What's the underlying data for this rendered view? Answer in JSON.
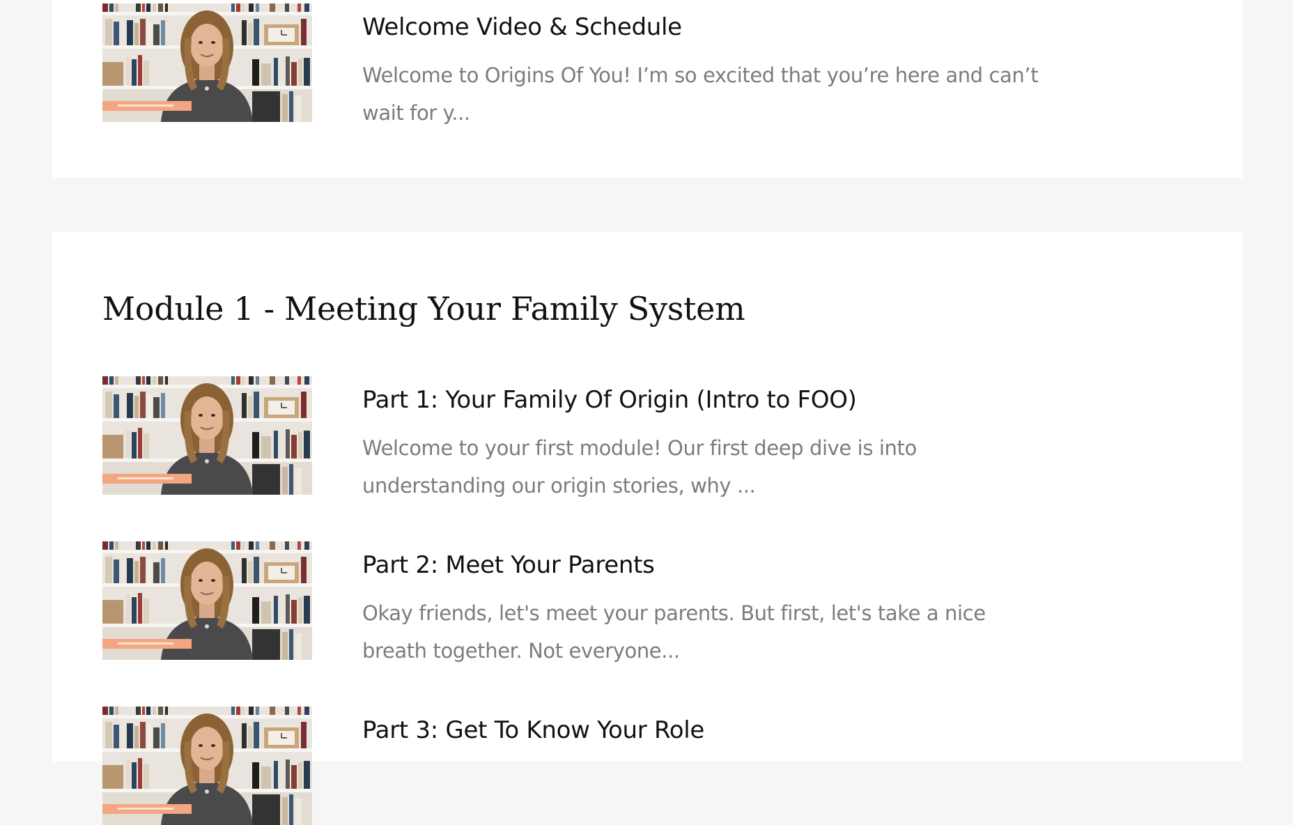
{
  "intro": {
    "lesson": {
      "title": "Welcome Video & Schedule",
      "description": "Welcome to Origins Of You! I’m so excited that you’re here and can’t wait for y..."
    }
  },
  "module1": {
    "title": "Module 1 - Meeting Your Family System",
    "lessons": [
      {
        "title": "Part 1: Your Family Of Origin (Intro to FOO)",
        "description": "Welcome to your first module! Our first deep dive is into understanding our origin stories, why ..."
      },
      {
        "title": "Part 2: Meet Your Parents",
        "description": "Okay friends, let's meet your parents. But first, let's take a nice breath together. Not everyone..."
      },
      {
        "title": "Part 3: Get To Know Your Role",
        "description": ""
      }
    ]
  },
  "colors": {
    "page_background": "#f6f6f6",
    "card_background": "#ffffff",
    "title_text": "#111111",
    "description_text": "#7c7c7c",
    "thumbnail_banner": "#f4a582"
  }
}
